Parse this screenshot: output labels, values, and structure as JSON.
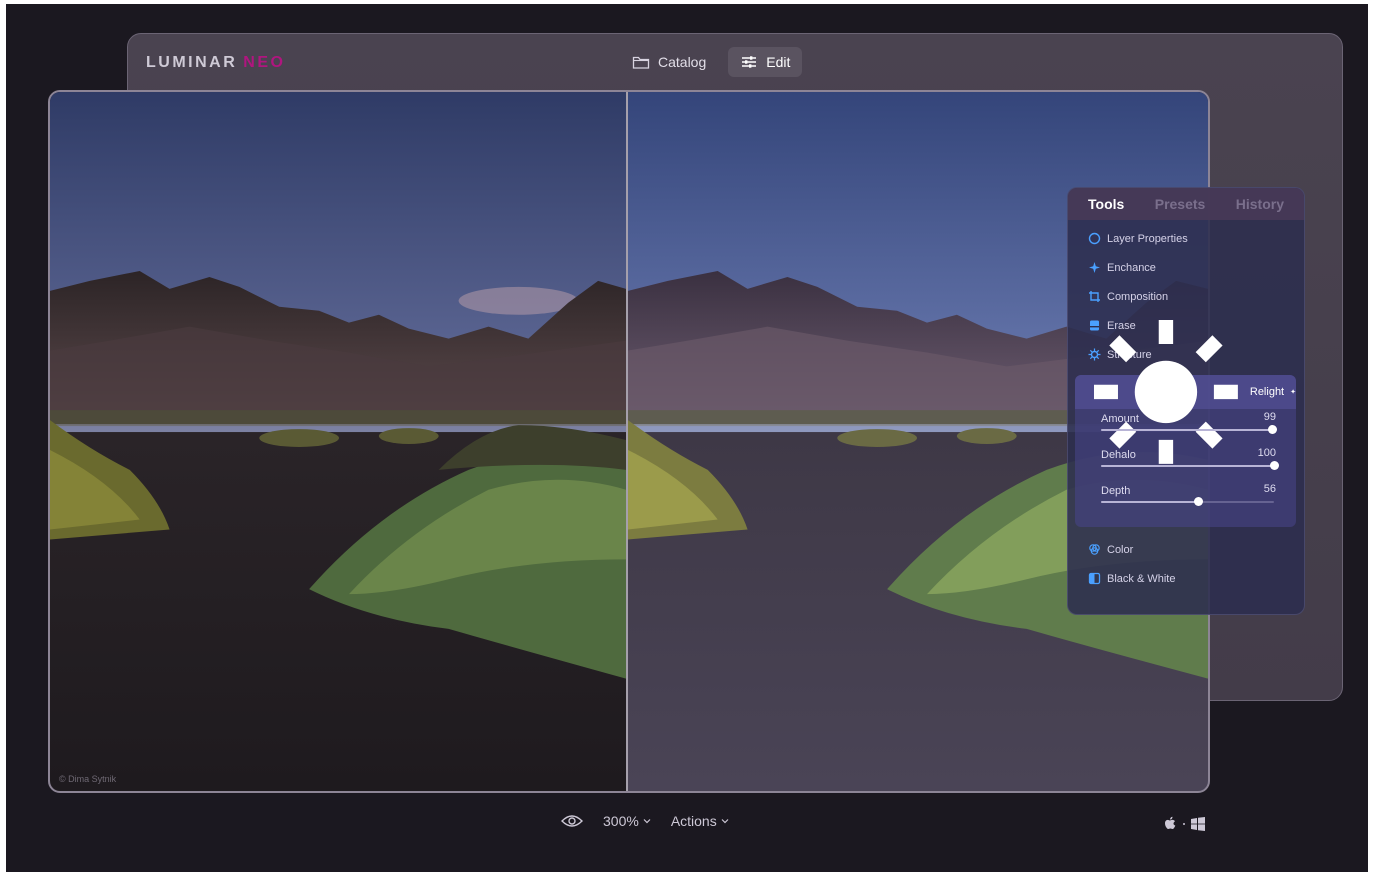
{
  "app": {
    "logo_text": "LUMINAR",
    "logo_suffix": "NEO",
    "brand_color": "#b0157f"
  },
  "topnav": {
    "items": [
      {
        "label": "Catalog",
        "icon": "folder-icon",
        "active": false
      },
      {
        "label": "Edit",
        "icon": "sliders-icon",
        "active": true
      }
    ]
  },
  "photo": {
    "credit": "© Dima Sytnik"
  },
  "panel": {
    "tabs": [
      {
        "label": "Tools",
        "active": true
      },
      {
        "label": "Presets",
        "active": false
      },
      {
        "label": "History",
        "active": false
      }
    ],
    "tools_top": [
      {
        "label": "Layer Properties",
        "icon": "layers-icon"
      },
      {
        "label": "Enchance",
        "icon": "enhance-icon"
      },
      {
        "label": "Composition",
        "icon": "crop-icon"
      },
      {
        "label": "Erase",
        "icon": "eraser-icon"
      },
      {
        "label": "Structure",
        "icon": "structure-icon"
      }
    ],
    "relight": {
      "label": "Relight",
      "icon": "sun-icon",
      "sliders": [
        {
          "label": "Amount",
          "value": 99
        },
        {
          "label": "Dehalo",
          "value": 100
        },
        {
          "label": "Depth",
          "value": 56
        }
      ]
    },
    "tools_bottom": [
      {
        "label": "Color",
        "icon": "color-icon"
      },
      {
        "label": "Black & White",
        "icon": "bw-icon"
      }
    ]
  },
  "bottom_bar": {
    "view_icon": "eye-icon",
    "zoom": "300%",
    "actions": "Actions"
  },
  "os_icons": [
    "apple-icon",
    "windows-icon"
  ]
}
